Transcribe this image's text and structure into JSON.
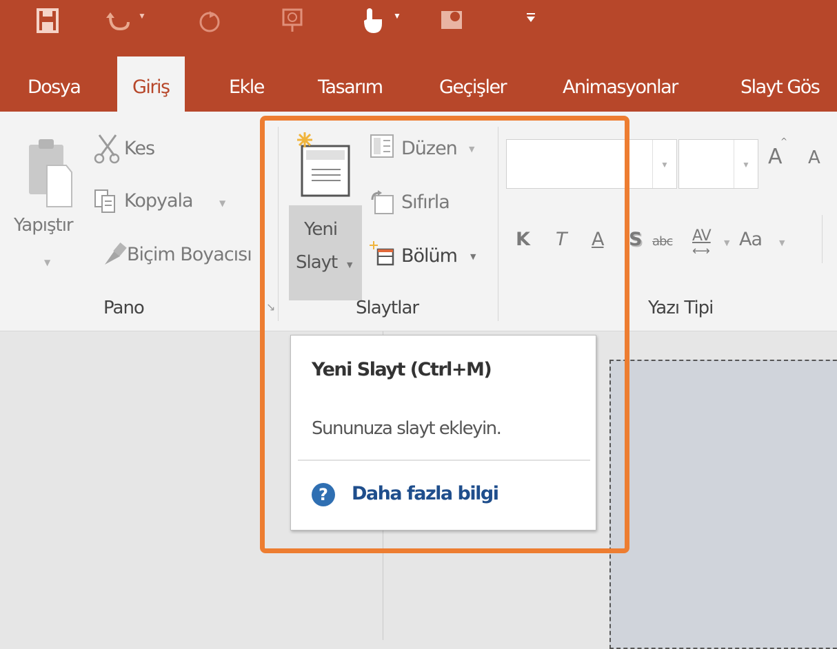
{
  "quick_access": {
    "icons": [
      "save-icon",
      "undo-icon",
      "redo-icon",
      "start-slideshow-icon",
      "touch-mode-icon",
      "record-icon",
      "customize-icon"
    ]
  },
  "tabs": [
    {
      "label": "Dosya",
      "active": false
    },
    {
      "label": "Giriş",
      "active": true
    },
    {
      "label": "Ekle",
      "active": false
    },
    {
      "label": "Tasarım",
      "active": false
    },
    {
      "label": "Geçişler",
      "active": false
    },
    {
      "label": "Animasyonlar",
      "active": false
    },
    {
      "label": "Slayt Gös",
      "active": false
    }
  ],
  "ribbon": {
    "pano": {
      "paste_label": "Yapıştır",
      "cut_label": "Kes",
      "copy_label": "Kopyala",
      "format_painter_label": "Biçim Boyacısı",
      "group_label": "Pano"
    },
    "slaytlar": {
      "new_slide_line1": "Yeni",
      "new_slide_line2": "Slayt",
      "layout_label": "Düzen",
      "reset_label": "Sıfırla",
      "section_label": "Bölüm",
      "group_label": "Slaytlar"
    },
    "yazi_tipi": {
      "bold": "K",
      "italic": "T",
      "underline": "A",
      "shadow": "S",
      "strikethrough": "abc",
      "spacing": "AV",
      "change_case": "Aa",
      "grow_font": "A",
      "shrink_font": "A",
      "group_label": "Yazı Tipi"
    }
  },
  "tooltip": {
    "title": "Yeni Slayt (Ctrl+M)",
    "description": "Sununuza slayt ekleyin.",
    "help_link": "Daha fazla bilgi",
    "help_icon_glyph": "?"
  },
  "colors": {
    "accent": "#b7472a",
    "highlight": "#ed7d31",
    "help_blue": "#2f6fb2"
  }
}
